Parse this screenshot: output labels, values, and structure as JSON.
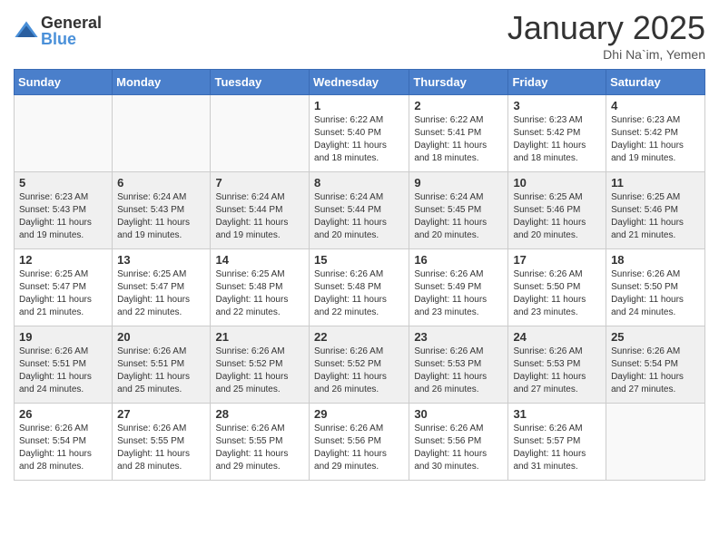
{
  "logo": {
    "general": "General",
    "blue": "Blue"
  },
  "header": {
    "month": "January 2025",
    "location": "Dhi Na`im, Yemen"
  },
  "weekdays": [
    "Sunday",
    "Monday",
    "Tuesday",
    "Wednesday",
    "Thursday",
    "Friday",
    "Saturday"
  ],
  "weeks": [
    [
      {
        "day": "",
        "info": ""
      },
      {
        "day": "",
        "info": ""
      },
      {
        "day": "",
        "info": ""
      },
      {
        "day": "1",
        "info": "Sunrise: 6:22 AM\nSunset: 5:40 PM\nDaylight: 11 hours and 18 minutes."
      },
      {
        "day": "2",
        "info": "Sunrise: 6:22 AM\nSunset: 5:41 PM\nDaylight: 11 hours and 18 minutes."
      },
      {
        "day": "3",
        "info": "Sunrise: 6:23 AM\nSunset: 5:42 PM\nDaylight: 11 hours and 18 minutes."
      },
      {
        "day": "4",
        "info": "Sunrise: 6:23 AM\nSunset: 5:42 PM\nDaylight: 11 hours and 19 minutes."
      }
    ],
    [
      {
        "day": "5",
        "info": "Sunrise: 6:23 AM\nSunset: 5:43 PM\nDaylight: 11 hours and 19 minutes."
      },
      {
        "day": "6",
        "info": "Sunrise: 6:24 AM\nSunset: 5:43 PM\nDaylight: 11 hours and 19 minutes."
      },
      {
        "day": "7",
        "info": "Sunrise: 6:24 AM\nSunset: 5:44 PM\nDaylight: 11 hours and 19 minutes."
      },
      {
        "day": "8",
        "info": "Sunrise: 6:24 AM\nSunset: 5:44 PM\nDaylight: 11 hours and 20 minutes."
      },
      {
        "day": "9",
        "info": "Sunrise: 6:24 AM\nSunset: 5:45 PM\nDaylight: 11 hours and 20 minutes."
      },
      {
        "day": "10",
        "info": "Sunrise: 6:25 AM\nSunset: 5:46 PM\nDaylight: 11 hours and 20 minutes."
      },
      {
        "day": "11",
        "info": "Sunrise: 6:25 AM\nSunset: 5:46 PM\nDaylight: 11 hours and 21 minutes."
      }
    ],
    [
      {
        "day": "12",
        "info": "Sunrise: 6:25 AM\nSunset: 5:47 PM\nDaylight: 11 hours and 21 minutes."
      },
      {
        "day": "13",
        "info": "Sunrise: 6:25 AM\nSunset: 5:47 PM\nDaylight: 11 hours and 22 minutes."
      },
      {
        "day": "14",
        "info": "Sunrise: 6:25 AM\nSunset: 5:48 PM\nDaylight: 11 hours and 22 minutes."
      },
      {
        "day": "15",
        "info": "Sunrise: 6:26 AM\nSunset: 5:48 PM\nDaylight: 11 hours and 22 minutes."
      },
      {
        "day": "16",
        "info": "Sunrise: 6:26 AM\nSunset: 5:49 PM\nDaylight: 11 hours and 23 minutes."
      },
      {
        "day": "17",
        "info": "Sunrise: 6:26 AM\nSunset: 5:50 PM\nDaylight: 11 hours and 23 minutes."
      },
      {
        "day": "18",
        "info": "Sunrise: 6:26 AM\nSunset: 5:50 PM\nDaylight: 11 hours and 24 minutes."
      }
    ],
    [
      {
        "day": "19",
        "info": "Sunrise: 6:26 AM\nSunset: 5:51 PM\nDaylight: 11 hours and 24 minutes."
      },
      {
        "day": "20",
        "info": "Sunrise: 6:26 AM\nSunset: 5:51 PM\nDaylight: 11 hours and 25 minutes."
      },
      {
        "day": "21",
        "info": "Sunrise: 6:26 AM\nSunset: 5:52 PM\nDaylight: 11 hours and 25 minutes."
      },
      {
        "day": "22",
        "info": "Sunrise: 6:26 AM\nSunset: 5:52 PM\nDaylight: 11 hours and 26 minutes."
      },
      {
        "day": "23",
        "info": "Sunrise: 6:26 AM\nSunset: 5:53 PM\nDaylight: 11 hours and 26 minutes."
      },
      {
        "day": "24",
        "info": "Sunrise: 6:26 AM\nSunset: 5:53 PM\nDaylight: 11 hours and 27 minutes."
      },
      {
        "day": "25",
        "info": "Sunrise: 6:26 AM\nSunset: 5:54 PM\nDaylight: 11 hours and 27 minutes."
      }
    ],
    [
      {
        "day": "26",
        "info": "Sunrise: 6:26 AM\nSunset: 5:54 PM\nDaylight: 11 hours and 28 minutes."
      },
      {
        "day": "27",
        "info": "Sunrise: 6:26 AM\nSunset: 5:55 PM\nDaylight: 11 hours and 28 minutes."
      },
      {
        "day": "28",
        "info": "Sunrise: 6:26 AM\nSunset: 5:55 PM\nDaylight: 11 hours and 29 minutes."
      },
      {
        "day": "29",
        "info": "Sunrise: 6:26 AM\nSunset: 5:56 PM\nDaylight: 11 hours and 29 minutes."
      },
      {
        "day": "30",
        "info": "Sunrise: 6:26 AM\nSunset: 5:56 PM\nDaylight: 11 hours and 30 minutes."
      },
      {
        "day": "31",
        "info": "Sunrise: 6:26 AM\nSunset: 5:57 PM\nDaylight: 11 hours and 31 minutes."
      },
      {
        "day": "",
        "info": ""
      }
    ]
  ]
}
